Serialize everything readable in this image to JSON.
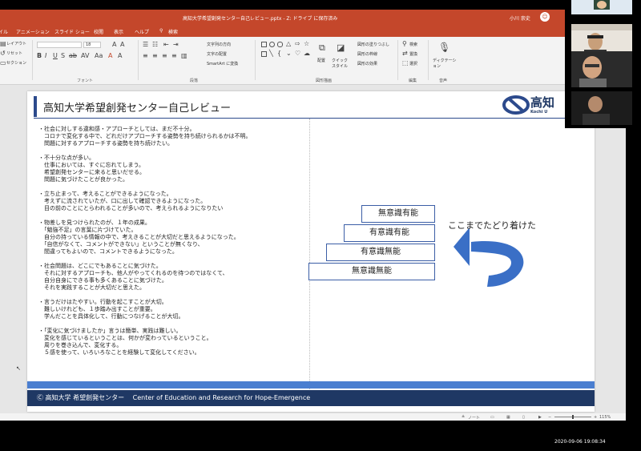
{
  "window": {
    "title": "高知大学希望創発センター自己レビュー.pptx - Z: ドライブ に保存済み",
    "user": "小川 崇史"
  },
  "menu": [
    "ファイル",
    "ホーム",
    "挿入",
    "アニメーション",
    "スライド ショー",
    "校閲",
    "表示",
    "ヘルプ",
    "検索"
  ],
  "ribbon": {
    "layout": "レイアウト",
    "reset": "リセット",
    "section": "セクション",
    "font_group": "フォント",
    "paragraph_group": "段落",
    "drawing_group": "図形描画",
    "edit_group": "編集",
    "voice_group": "音声",
    "text_direction": "文字列の方向",
    "text_align": "文字の配置",
    "smartart": "SmartArt に変換",
    "arrange": "配置",
    "quick_styles": "クイック スタイル",
    "shape_fill": "図形の塗りつぶし",
    "shape_outline": "図形の枠線",
    "shape_effects": "図形の効果",
    "find": "検索",
    "replace": "置換",
    "select": "選択",
    "dictation": "ディクテーション",
    "font_size": "18"
  },
  "slide": {
    "title": "高知大学希望創発センター自己レビュー",
    "logo_text": "高知",
    "logo_sub": "Kochi U",
    "paragraphs": [
      [
        "・社会に対しする違和感・アプローチとしては、まだ不十分。",
        "　コロナで変化する中で、どれだけアプローチする姿勢を持ち続けられるかは不明。",
        "　問題に対するアプローチする姿勢を持ち続けたい。"
      ],
      [
        "・不十分な点が多い。",
        "　仕事においては、すぐに忘れてしまう。",
        "　希望創発センターに来ると思いだせる。",
        "　問題に気づけたことが良かった。"
      ],
      [
        "・立ち止まって、考えることができるようになった。",
        "　考えずに流されていたが、口に出して確認できるようになった。",
        "　目の前のことにとらわれることが多いので、考えられるようになりたい"
      ],
      [
        "・物差しを見つけられたのが、１年の成果。",
        "　「勉強不足」の言葉に片づけていた。",
        "　自分の持っている情報の中で、考えきることが大切だと思えるようになった。",
        "　「自信がなくて、コメントができない」ということが無くなり、",
        "　間違ってもよいので、コメントできるようになった。"
      ],
      [
        "・社会問題は、どこにでもあることに気づけた。",
        "　それに対するアプローチも、他人がやってくれるのを待つのではなくて、",
        "　自分自身にできる事も多くあることに気づけた。",
        "　それを実践することが大切だと思えた。"
      ],
      [
        "・言うだけはたやすい。行動を起こすことが大切。",
        "　難しいけれども、１歩踏み出すことが重要。",
        "　学んだことを具体化して、行動につなげることが大切。"
      ],
      [
        "・「変化に気づけましたか」言うは簡単、実践は難しい。",
        "　変化を感じているということは、何かが変わっているということ。",
        "　周りを巻き込んで、変化する。",
        "　５感を使って、いろいろなことを経験して変化してください。"
      ]
    ],
    "stairs": [
      "無意識有能",
      "有意識有能",
      "有意識無能",
      "無意識無能"
    ],
    "annotation": "ここまでたどり着けた",
    "footer": "Ⓒ 高知大学 希望創発センター　 Center of Education and Research for Hope-Emergence"
  },
  "status": {
    "notes": "ノート",
    "zoom": "115%"
  },
  "clock": "2020-09-06  19:08:34",
  "colors": {
    "titlebar": "#c4472b",
    "accent": "#2c4a8c",
    "footer": "#1f3864",
    "stripe": "#4a7ed0",
    "arrow": "#3a6fc6"
  }
}
